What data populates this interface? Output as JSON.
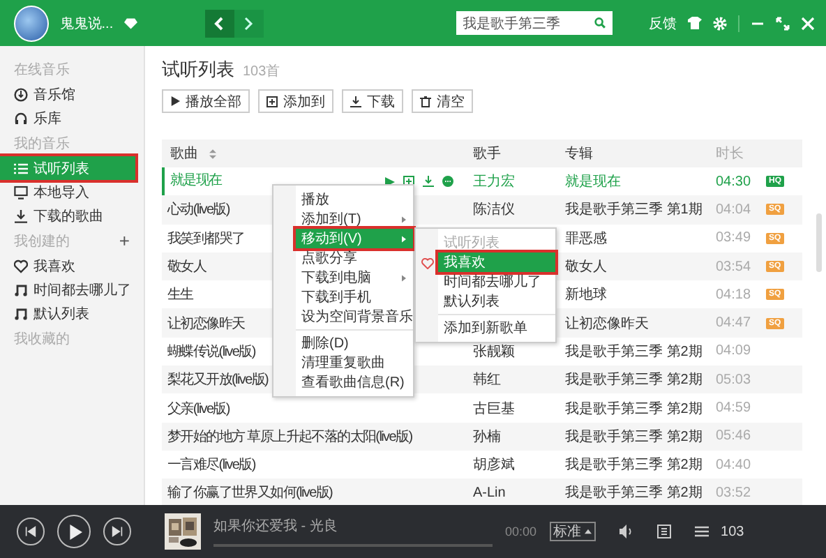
{
  "top_bar": {
    "username": "鬼鬼说...",
    "search": {
      "value": "我是歌手第三季"
    },
    "feedback": "反馈"
  },
  "sidebar": {
    "sections": [
      {
        "heading": "在线音乐",
        "items": [
          {
            "label": "音乐馆",
            "selected": false,
            "annotated": false
          },
          {
            "label": "乐库",
            "selected": false,
            "annotated": false
          }
        ]
      },
      {
        "heading": "我的音乐",
        "items": [
          {
            "label": "试听列表",
            "selected": true,
            "annotated": true
          },
          {
            "label": "本地导入",
            "selected": false,
            "annotated": false
          },
          {
            "label": "下载的歌曲",
            "selected": false,
            "annotated": false
          }
        ]
      },
      {
        "heading": "我创建的",
        "action": "+",
        "items": [
          {
            "label": "我喜欢",
            "selected": false,
            "annotated": false
          },
          {
            "label": "时间都去哪儿了",
            "selected": false,
            "annotated": false
          },
          {
            "label": "默认列表",
            "selected": false,
            "annotated": false
          }
        ]
      },
      {
        "heading": "我收藏的"
      }
    ]
  },
  "playlist": {
    "title": "试听列表",
    "count": "103首",
    "toolbar": [
      "播放全部",
      "添加到",
      "下载",
      "清空"
    ],
    "columns": [
      {
        "label": "歌曲",
        "sortable": true
      },
      {
        "label": "歌手",
        "sortable": false
      },
      {
        "label": "专辑",
        "sortable": false
      },
      {
        "label": "时长",
        "sortable": false
      }
    ],
    "rows": [
      {
        "song": "就是现在",
        "singer": "王力宏",
        "album": "就是现在",
        "duration": "04:30",
        "badge": {
          "text": "HQ",
          "color": "#1fa14a"
        },
        "playing": true
      },
      {
        "song": "心动(live版)",
        "singer": "陈洁仪",
        "album": "我是歌手第三季 第1期",
        "duration": "04:04",
        "badge": {
          "text": "SQ",
          "color": "#f0a040"
        },
        "playing": false
      },
      {
        "song": "我笑到都哭了",
        "album": "罪恶感",
        "duration": "03:49",
        "badge": {
          "text": "SQ",
          "color": "#f0a040"
        },
        "playing": false
      },
      {
        "song": "敬女人",
        "album": "敬女人",
        "duration": "03:54",
        "badge": {
          "text": "SQ",
          "color": "#f0a040"
        },
        "playing": false
      },
      {
        "song": "生生",
        "album": "新地球",
        "duration": "04:18",
        "badge": {
          "text": "SQ",
          "color": "#f0a040"
        },
        "playing": false
      },
      {
        "song": "让初恋像昨天",
        "album": "让初恋像昨天",
        "duration": "04:47",
        "badge": {
          "text": "SQ",
          "color": "#f0a040"
        },
        "playing": false
      },
      {
        "song": "蝴蝶传说(live版)",
        "singer": "张靓颖",
        "album": "我是歌手第三季 第2期",
        "duration": "04:09",
        "playing": false
      },
      {
        "song": "梨花又开放(live版)",
        "singer": "韩红",
        "album": "我是歌手第三季 第2期",
        "duration": "05:03",
        "playing": false
      },
      {
        "song": "父亲(live版)",
        "singer": "古巨基",
        "album": "我是歌手第三季 第2期",
        "duration": "04:59",
        "playing": false
      },
      {
        "song": "梦开始的地方  草原上升起不落的太阳(live版)",
        "singer": "孙楠",
        "album": "我是歌手第三季 第2期",
        "duration": "05:46",
        "playing": false
      },
      {
        "song": "一言难尽(live版)",
        "singer": "胡彦斌",
        "album": "我是歌手第三季 第2期",
        "duration": "04:40",
        "playing": false
      },
      {
        "song": "输了你赢了世界又如何(live版)",
        "singer": "A-Lin",
        "album": "我是歌手第三季 第2期",
        "duration": "03:52",
        "playing": false
      }
    ]
  },
  "context_menu": {
    "groups": [
      [
        {
          "label": "播放",
          "submenu": false,
          "selected": false,
          "annotated": false
        },
        {
          "label": "添加到(T)",
          "submenu": true,
          "selected": false,
          "annotated": false
        },
        {
          "label": "移动到(V)",
          "submenu": true,
          "selected": true,
          "annotated": true
        },
        {
          "label": "点歌分享",
          "submenu": false,
          "selected": false,
          "annotated": false
        },
        {
          "label": "下载到电脑",
          "submenu": true,
          "selected": false,
          "annotated": false
        },
        {
          "label": "下载到手机",
          "submenu": false,
          "selected": false,
          "annotated": false
        },
        {
          "label": "设为空间背景音乐",
          "submenu": false,
          "selected": false,
          "annotated": false
        }
      ],
      [
        {
          "label": "删除(D)",
          "submenu": false,
          "selected": false,
          "annotated": false
        },
        {
          "label": "清理重复歌曲",
          "submenu": false,
          "selected": false,
          "annotated": false
        },
        {
          "label": "查看歌曲信息(R)",
          "submenu": false,
          "selected": false,
          "annotated": false
        }
      ]
    ]
  },
  "submenu": {
    "groups": [
      [
        {
          "label": "试听列表",
          "disabled": true,
          "selected": false,
          "annotated": false
        },
        {
          "label": "我喜欢",
          "disabled": false,
          "selected": true,
          "annotated": true
        },
        {
          "label": "时间都去哪儿了",
          "disabled": false,
          "selected": false,
          "annotated": false
        },
        {
          "label": "默认列表",
          "disabled": false,
          "selected": false,
          "annotated": false
        }
      ],
      [
        {
          "label": "添加到新歌单",
          "disabled": false,
          "selected": false,
          "annotated": false
        }
      ]
    ]
  },
  "player": {
    "now_playing": "如果你还爱我 - 光良",
    "time": "00:00",
    "level": 0.0,
    "quality": "标准",
    "count": "103"
  }
}
